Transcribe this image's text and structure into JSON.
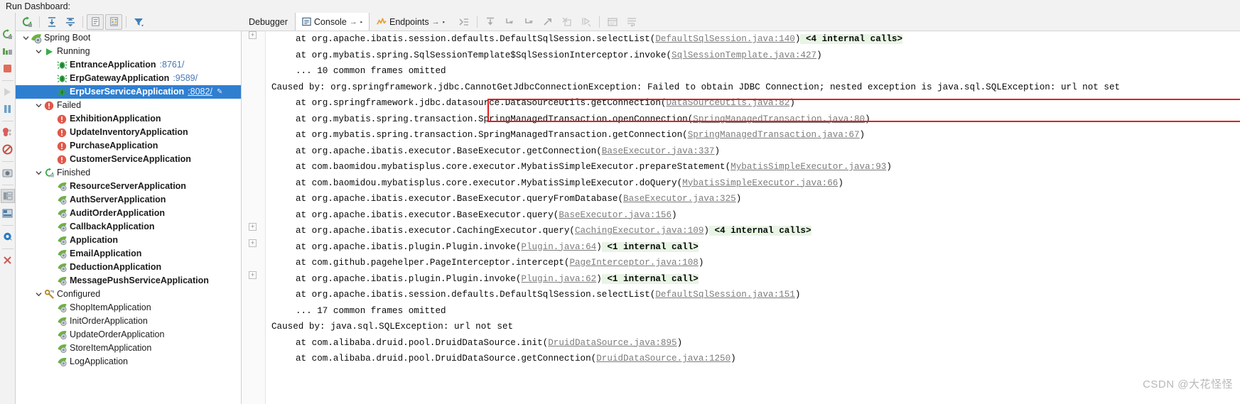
{
  "window": {
    "title": "Run Dashboard:"
  },
  "left_toolstrip": [
    {
      "name": "rerun-icon",
      "glyph": "rerun"
    },
    {
      "name": "rerun-failed-tests-icon",
      "glyph": "rerun-failed"
    },
    {
      "name": "stop-icon",
      "glyph": "stop"
    },
    {
      "name": "resume-program-icon",
      "glyph": "resume"
    },
    {
      "name": "pause-program-icon",
      "glyph": "pause"
    },
    {
      "name": "view-breakpoints-icon",
      "glyph": "breakpoints"
    },
    {
      "name": "mute-breakpoints-icon",
      "glyph": "mute-breakpoints"
    },
    {
      "name": "settings-camera-icon",
      "glyph": "camera"
    },
    {
      "name": "layout-icon",
      "glyph": "layout"
    },
    {
      "name": "restore-layout-icon",
      "glyph": "restore-layout"
    },
    {
      "name": "settings-gear-icon",
      "glyph": "gear"
    },
    {
      "name": "close-icon",
      "glyph": "close"
    }
  ],
  "dashboard_toolbar": [
    {
      "name": "rerun-icon",
      "glyph": "rerun-green",
      "framed": false
    },
    {
      "name": "expand-all-icon",
      "glyph": "expand-all",
      "framed": false
    },
    {
      "name": "collapse-all-icon",
      "glyph": "collapse-all",
      "framed": false
    },
    {
      "name": "show-configurations-icon",
      "glyph": "list-panel",
      "framed": true
    },
    {
      "name": "group-by-icon",
      "glyph": "list-panel-2",
      "framed": true
    },
    {
      "name": "filter-icon",
      "glyph": "filter",
      "framed": false
    }
  ],
  "tree": [
    {
      "depth": 0,
      "twisty": "v",
      "icon": "spring-boot-icon",
      "label": "Spring Boot",
      "bold": false,
      "port": "",
      "selected": false
    },
    {
      "depth": 1,
      "twisty": "v",
      "icon": "running-icon",
      "label": "Running",
      "bold": false,
      "port": "",
      "selected": false
    },
    {
      "depth": 2,
      "twisty": "",
      "icon": "spring-app-running-icon",
      "label": "EntranceApplication",
      "bold": true,
      "port": ":8761/",
      "selected": false
    },
    {
      "depth": 2,
      "twisty": "",
      "icon": "spring-app-running-icon",
      "label": "ErpGatewayApplication",
      "bold": true,
      "port": ":9589/",
      "selected": false
    },
    {
      "depth": 2,
      "twisty": "",
      "icon": "spring-app-running-icon",
      "label": "ErpUserServiceApplication",
      "bold": true,
      "port": ":8082/",
      "selected": true
    },
    {
      "depth": 1,
      "twisty": "v",
      "icon": "failed-icon",
      "label": "Failed",
      "bold": false,
      "port": "",
      "selected": false
    },
    {
      "depth": 2,
      "twisty": "",
      "icon": "failed-icon",
      "label": "ExhibitionApplication",
      "bold": true,
      "port": "",
      "selected": false
    },
    {
      "depth": 2,
      "twisty": "",
      "icon": "failed-icon",
      "label": "UpdateInventoryApplication",
      "bold": true,
      "port": "",
      "selected": false
    },
    {
      "depth": 2,
      "twisty": "",
      "icon": "failed-icon",
      "label": "PurchaseApplication",
      "bold": true,
      "port": "",
      "selected": false
    },
    {
      "depth": 2,
      "twisty": "",
      "icon": "failed-icon",
      "label": "CustomerServiceApplication",
      "bold": true,
      "port": "",
      "selected": false
    },
    {
      "depth": 1,
      "twisty": "v",
      "icon": "finished-icon",
      "label": "Finished",
      "bold": false,
      "port": "",
      "selected": false
    },
    {
      "depth": 2,
      "twisty": "",
      "icon": "spring-leaf-icon",
      "label": "ResourceServerApplication",
      "bold": true,
      "port": "",
      "selected": false
    },
    {
      "depth": 2,
      "twisty": "",
      "icon": "spring-leaf-icon",
      "label": "AuthServerApplication",
      "bold": true,
      "port": "",
      "selected": false
    },
    {
      "depth": 2,
      "twisty": "",
      "icon": "spring-leaf-icon",
      "label": "AuditOrderApplication",
      "bold": true,
      "port": "",
      "selected": false
    },
    {
      "depth": 2,
      "twisty": "",
      "icon": "spring-leaf-icon",
      "label": "CallbackApplication",
      "bold": true,
      "port": "",
      "selected": false
    },
    {
      "depth": 2,
      "twisty": "",
      "icon": "spring-leaf-icon",
      "label": "Application",
      "bold": true,
      "port": "",
      "selected": false
    },
    {
      "depth": 2,
      "twisty": "",
      "icon": "spring-leaf-icon",
      "label": "EmailApplication",
      "bold": true,
      "port": "",
      "selected": false
    },
    {
      "depth": 2,
      "twisty": "",
      "icon": "spring-leaf-icon",
      "label": "DeductionApplication",
      "bold": true,
      "port": "",
      "selected": false
    },
    {
      "depth": 2,
      "twisty": "",
      "icon": "spring-leaf-icon",
      "label": "MessagePushServiceApplication",
      "bold": true,
      "port": "",
      "selected": false
    },
    {
      "depth": 1,
      "twisty": "v",
      "icon": "configured-icon",
      "label": "Configured",
      "bold": false,
      "port": "",
      "selected": false
    },
    {
      "depth": 2,
      "twisty": "",
      "icon": "spring-leaf-icon",
      "label": "ShopItemApplication",
      "bold": false,
      "port": "",
      "selected": false
    },
    {
      "depth": 2,
      "twisty": "",
      "icon": "spring-leaf-icon",
      "label": "InitOrderApplication",
      "bold": false,
      "port": "",
      "selected": false
    },
    {
      "depth": 2,
      "twisty": "",
      "icon": "spring-leaf-icon",
      "label": "UpdateOrderApplication",
      "bold": false,
      "port": "",
      "selected": false
    },
    {
      "depth": 2,
      "twisty": "",
      "icon": "spring-leaf-icon",
      "label": "StoreItemApplication",
      "bold": false,
      "port": "",
      "selected": false
    },
    {
      "depth": 2,
      "twisty": "",
      "icon": "spring-leaf-icon",
      "label": "LogApplication",
      "bold": false,
      "port": "",
      "selected": false
    }
  ],
  "tabs": [
    {
      "label": "Debugger",
      "active": false,
      "icon": "",
      "arrow": false
    },
    {
      "label": "Console",
      "active": true,
      "icon": "console-icon",
      "arrow": true
    },
    {
      "label": "Endpoints",
      "active": false,
      "icon": "endpoints-icon",
      "arrow": true
    }
  ],
  "console_tools": [
    {
      "name": "trace-current-stream-icon",
      "glyph": "trace"
    },
    {
      "name": "step-over-icon",
      "glyph": "step-over"
    },
    {
      "name": "step-into-icon",
      "glyph": "step-into"
    },
    {
      "name": "force-step-into-icon",
      "glyph": "force-step-into"
    },
    {
      "name": "step-out-icon",
      "glyph": "step-out"
    },
    {
      "name": "drop-frame-icon",
      "glyph": "drop-frame"
    },
    {
      "name": "run-to-cursor-icon",
      "glyph": "run-to-cursor"
    },
    {
      "name": "evaluate-expression-icon",
      "glyph": "evaluate"
    },
    {
      "name": "soft-wrap-icon",
      "glyph": "soft-wrap"
    }
  ],
  "console_lines": [
    {
      "indent": 1,
      "fold": false,
      "highlight": false,
      "parts": [
        {
          "t": "at org.apache.ibatis.session.defaults.DefaultSqlSession.selectList(",
          "k": "plain"
        },
        {
          "t": "DefaultSqlSession.java:140",
          "k": "link"
        },
        {
          "t": ")",
          "k": "plain"
        },
        {
          "t": " <4 internal calls>",
          "k": "internal"
        }
      ],
      "foldmark": true
    },
    {
      "indent": 1,
      "fold": false,
      "highlight": false,
      "parts": [
        {
          "t": "at org.mybatis.spring.SqlSessionTemplate$SqlSessionInterceptor.invoke(",
          "k": "plain"
        },
        {
          "t": "SqlSessionTemplate.java:427",
          "k": "link"
        },
        {
          "t": ")",
          "k": "plain"
        }
      ]
    },
    {
      "indent": 1,
      "fold": false,
      "highlight": false,
      "parts": [
        {
          "t": "... 10 common frames omitted",
          "k": "plain"
        }
      ]
    },
    {
      "indent": 0,
      "fold": false,
      "highlight": true,
      "parts": [
        {
          "t": "Caused by: org.springframework.jdbc.CannotGetJdbcConnectionException: Failed to obtain JDBC Connection; nested exception is java.sql.SQLException: url not set",
          "k": "plain"
        }
      ]
    },
    {
      "indent": 1,
      "fold": false,
      "highlight": false,
      "parts": [
        {
          "t": "at org.springframework.jdbc.datasource.DataSourceUtils.getConnection(",
          "k": "plain"
        },
        {
          "t": "DataSourceUtils.java:82",
          "k": "link"
        },
        {
          "t": ")",
          "k": "plain"
        }
      ]
    },
    {
      "indent": 1,
      "fold": false,
      "highlight": false,
      "parts": [
        {
          "t": "at org.mybatis.spring.transaction.SpringManagedTransaction.openConnection(",
          "k": "plain"
        },
        {
          "t": "SpringManagedTransaction.java:80",
          "k": "link"
        },
        {
          "t": ")",
          "k": "plain"
        }
      ]
    },
    {
      "indent": 1,
      "fold": false,
      "highlight": false,
      "parts": [
        {
          "t": "at org.mybatis.spring.transaction.SpringManagedTransaction.getConnection(",
          "k": "plain"
        },
        {
          "t": "SpringManagedTransaction.java:67",
          "k": "link"
        },
        {
          "t": ")",
          "k": "plain"
        }
      ]
    },
    {
      "indent": 1,
      "fold": false,
      "highlight": false,
      "parts": [
        {
          "t": "at org.apache.ibatis.executor.BaseExecutor.getConnection(",
          "k": "plain"
        },
        {
          "t": "BaseExecutor.java:337",
          "k": "link"
        },
        {
          "t": ")",
          "k": "plain"
        }
      ]
    },
    {
      "indent": 1,
      "fold": false,
      "highlight": false,
      "parts": [
        {
          "t": "at com.baomidou.mybatisplus.core.executor.MybatisSimpleExecutor.prepareStatement(",
          "k": "plain"
        },
        {
          "t": "MybatisSimpleExecutor.java:93",
          "k": "link"
        },
        {
          "t": ")",
          "k": "plain"
        }
      ]
    },
    {
      "indent": 1,
      "fold": false,
      "highlight": false,
      "parts": [
        {
          "t": "at com.baomidou.mybatisplus.core.executor.MybatisSimpleExecutor.doQuery(",
          "k": "plain"
        },
        {
          "t": "MybatisSimpleExecutor.java:66",
          "k": "link"
        },
        {
          "t": ")",
          "k": "plain"
        }
      ]
    },
    {
      "indent": 1,
      "fold": false,
      "highlight": false,
      "parts": [
        {
          "t": "at org.apache.ibatis.executor.BaseExecutor.queryFromDatabase(",
          "k": "plain"
        },
        {
          "t": "BaseExecutor.java:325",
          "k": "link"
        },
        {
          "t": ")",
          "k": "plain"
        }
      ]
    },
    {
      "indent": 1,
      "fold": false,
      "highlight": false,
      "parts": [
        {
          "t": "at org.apache.ibatis.executor.BaseExecutor.query(",
          "k": "plain"
        },
        {
          "t": "BaseExecutor.java:156",
          "k": "link"
        },
        {
          "t": ")",
          "k": "plain"
        }
      ]
    },
    {
      "indent": 1,
      "fold": true,
      "highlight": false,
      "parts": [
        {
          "t": "at org.apache.ibatis.executor.CachingExecutor.query(",
          "k": "plain"
        },
        {
          "t": "CachingExecutor.java:109",
          "k": "link"
        },
        {
          "t": ")",
          "k": "plain"
        },
        {
          "t": " <4 internal calls>",
          "k": "internal"
        }
      ]
    },
    {
      "indent": 1,
      "fold": true,
      "highlight": false,
      "parts": [
        {
          "t": "at org.apache.ibatis.plugin.Plugin.invoke(",
          "k": "plain"
        },
        {
          "t": "Plugin.java:64",
          "k": "link"
        },
        {
          "t": ")",
          "k": "plain"
        },
        {
          "t": " <1 internal call>",
          "k": "internal"
        }
      ]
    },
    {
      "indent": 1,
      "fold": false,
      "highlight": false,
      "parts": [
        {
          "t": "at com.github.pagehelper.PageInterceptor.intercept(",
          "k": "plain"
        },
        {
          "t": "PageInterceptor.java:108",
          "k": "link"
        },
        {
          "t": ")",
          "k": "plain"
        }
      ]
    },
    {
      "indent": 1,
      "fold": true,
      "highlight": false,
      "parts": [
        {
          "t": "at org.apache.ibatis.plugin.Plugin.invoke(",
          "k": "plain"
        },
        {
          "t": "Plugin.java:62",
          "k": "link"
        },
        {
          "t": ")",
          "k": "plain"
        },
        {
          "t": " <1 internal call>",
          "k": "internal"
        }
      ]
    },
    {
      "indent": 1,
      "fold": false,
      "highlight": false,
      "parts": [
        {
          "t": "at org.apache.ibatis.session.defaults.DefaultSqlSession.selectList(",
          "k": "plain"
        },
        {
          "t": "DefaultSqlSession.java:151",
          "k": "link"
        },
        {
          "t": ")",
          "k": "plain"
        }
      ]
    },
    {
      "indent": 1,
      "fold": false,
      "highlight": false,
      "parts": [
        {
          "t": "... 17 common frames omitted",
          "k": "plain"
        }
      ]
    },
    {
      "indent": 0,
      "fold": false,
      "highlight": false,
      "parts": [
        {
          "t": "Caused by: java.sql.SQLException: url not set",
          "k": "plain"
        }
      ]
    },
    {
      "indent": 1,
      "fold": false,
      "highlight": false,
      "parts": [
        {
          "t": "at com.alibaba.druid.pool.DruidDataSource.init(",
          "k": "plain"
        },
        {
          "t": "DruidDataSource.java:895",
          "k": "link"
        },
        {
          "t": ")",
          "k": "plain"
        }
      ]
    },
    {
      "indent": 1,
      "fold": false,
      "highlight": false,
      "parts": [
        {
          "t": "at com.alibaba.druid.pool.DruidDataSource.getConnection(",
          "k": "plain"
        },
        {
          "t": "DruidDataSource.java:1250",
          "k": "link"
        },
        {
          "t": ")",
          "k": "plain"
        }
      ]
    }
  ],
  "watermark": {
    "text": "CSDN @大花怪怪"
  },
  "colors": {
    "selection_blue": "#2f7fd1",
    "error_red": "#e02020",
    "link_gray": "#7c7c7c",
    "internal_green_bg": "#e8f5e4",
    "port_blue": "#4a78b5",
    "spring_green": "#6cb33e"
  }
}
